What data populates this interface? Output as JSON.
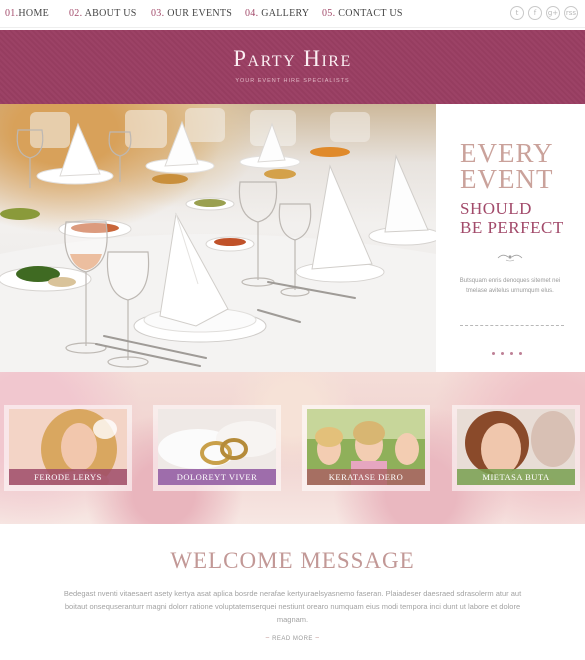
{
  "nav": {
    "items": [
      {
        "num": "01.",
        "label": "HOME"
      },
      {
        "num": "02.",
        "label": "ABOUT US"
      },
      {
        "num": "03.",
        "label": "OUR EVENTS"
      },
      {
        "num": "04.",
        "label": "GALLERY"
      },
      {
        "num": "05.",
        "label": "CONTACT US"
      }
    ],
    "social": [
      {
        "icon": "twitter-icon",
        "glyph": "t"
      },
      {
        "icon": "facebook-icon",
        "glyph": "f"
      },
      {
        "icon": "google-plus-icon",
        "glyph": "g+"
      },
      {
        "icon": "rss-icon",
        "glyph": "rss"
      }
    ]
  },
  "header": {
    "title": "Party Hire",
    "tagline": "YOUR EVENT HIRE SPECIALISTS"
  },
  "hero": {
    "line1": "EVERY",
    "line2": "EVENT",
    "line3": "SHOULD",
    "line4": "BE PERFECT",
    "text": "Butsquam enris denoques sitemet nei tmelase avitelus urnumqum elus.",
    "slide_count": 4
  },
  "gallery": {
    "cards": [
      {
        "label": "FERODE LERYS"
      },
      {
        "label": "DOLOREYT VIVER"
      },
      {
        "label": "KERATASE DERO"
      },
      {
        "label": "MIETASA BUTA"
      }
    ]
  },
  "welcome": {
    "title": "WELCOME MESSAGE",
    "text": "Bedegast nventi vitaesaert asety kertya asat aplica bosrde nerafae kertyuraelsyasnemo faseran. Plaiadeser daesraed sdrasolerm atur aut boitaut onsequseranturr magni dolorr ratione voluptatemserquei nestiunt orearo numquam eius modi tempora inci dunt ut labore et dolore magnam.",
    "read_more": "READ MORE"
  },
  "colors": {
    "brand": "#9a3e62",
    "accent": "#a24a6a",
    "soft_title": "#c29896"
  }
}
